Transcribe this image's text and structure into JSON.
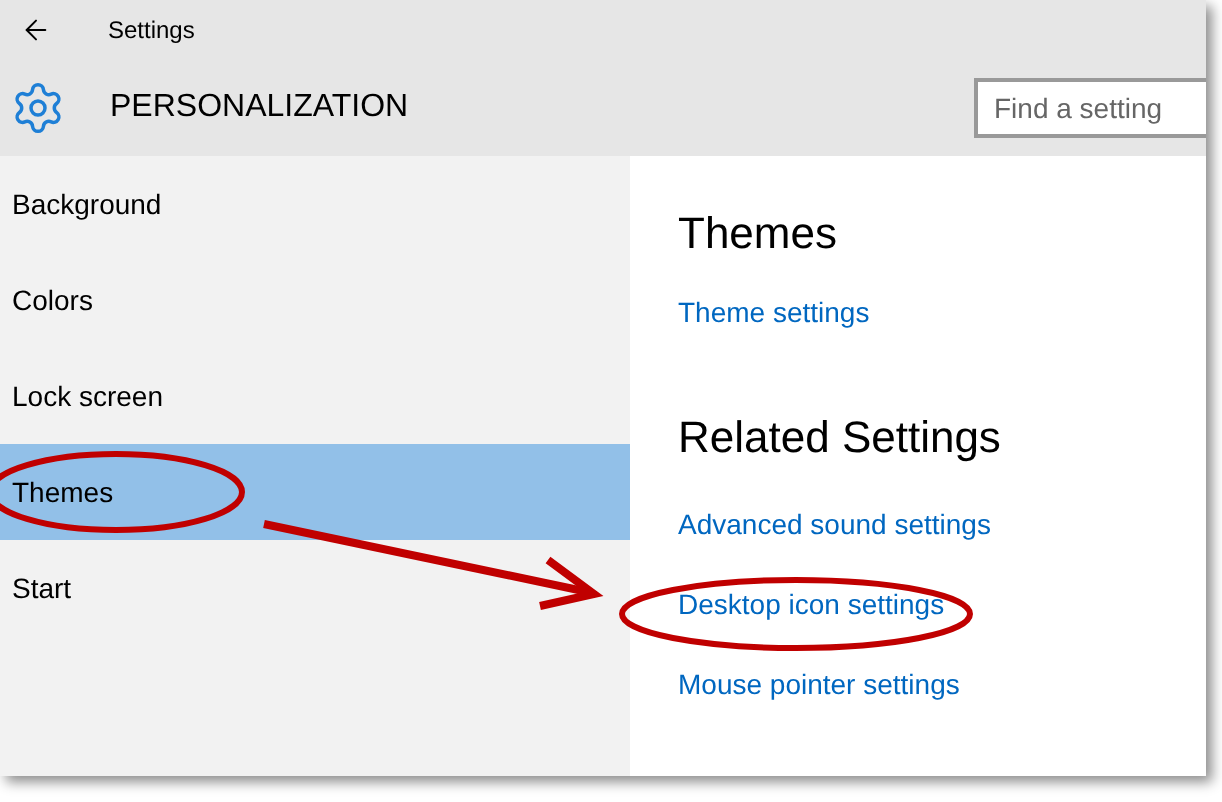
{
  "window": {
    "title": "Settings"
  },
  "header": {
    "title": "PERSONALIZATION",
    "search": {
      "placeholder": "Find a setting"
    }
  },
  "sidebar": {
    "items": [
      {
        "label": "Background",
        "selected": false
      },
      {
        "label": "Colors",
        "selected": false
      },
      {
        "label": "Lock screen",
        "selected": false
      },
      {
        "label": "Themes",
        "selected": true
      },
      {
        "label": "Start",
        "selected": false
      }
    ]
  },
  "content": {
    "heading": "Themes",
    "links": [
      "Theme settings"
    ],
    "related_heading": "Related Settings",
    "related_links": [
      "Advanced sound settings",
      "Desktop icon settings",
      "Mouse pointer settings"
    ]
  }
}
